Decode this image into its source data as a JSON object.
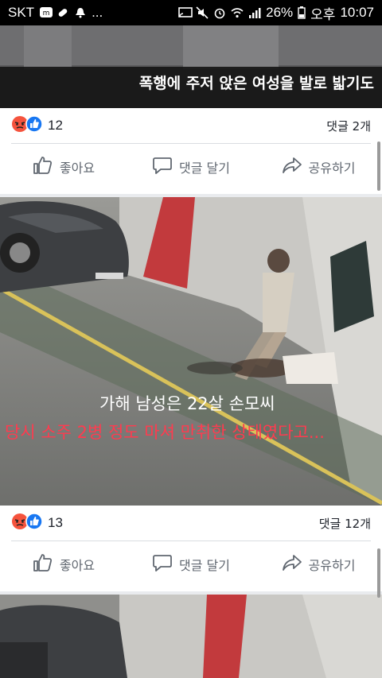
{
  "status_bar": {
    "carrier": "SKT",
    "more": "...",
    "battery": "26%",
    "ampm": "오후",
    "time": "10:07"
  },
  "video1": {
    "caption": "폭행에 주저 앉은 여성을 발로 밟기도"
  },
  "post1": {
    "reaction_count": "12",
    "comment_count": "댓글 2개",
    "like_label": "좋아요",
    "comment_label": "댓글 달기",
    "share_label": "공유하기"
  },
  "video2": {
    "caption_line1": "가해 남성은 22살 손모씨",
    "caption_line2": "당시 소주 2병 정도 마셔 만취한 상태였다고..."
  },
  "post2": {
    "reaction_count": "13",
    "comment_count": "댓글 12개",
    "like_label": "좋아요",
    "comment_label": "댓글 달기",
    "share_label": "공유하기"
  },
  "colors": {
    "angry": "#f5533d",
    "like": "#1877f2",
    "caption_red": "#ff3b4f"
  }
}
